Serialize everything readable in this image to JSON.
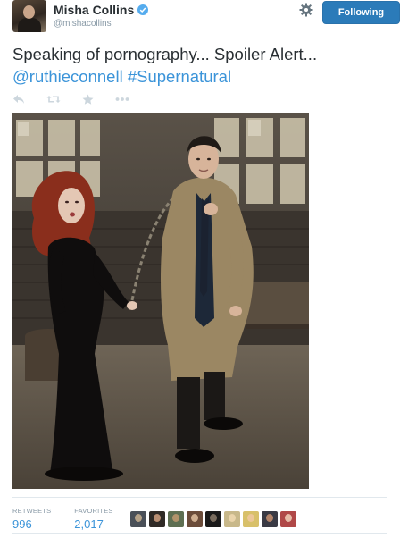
{
  "header": {
    "display_name": "Misha Collins",
    "handle": "@mishacollins",
    "verified_icon": "verified-badge-icon",
    "settings_icon": "gear-icon",
    "follow_label": "Following"
  },
  "tweet": {
    "text": "Speaking of pornography... Spoiler Alert...",
    "mention": "@ruthieconnell",
    "hashtag": "#Supernatural"
  },
  "actions": [
    "reply-icon",
    "retweet-icon",
    "favorite-icon",
    "more-icon"
  ],
  "stats": {
    "retweets_label": "RETWEETS",
    "retweets_value": "996",
    "favorites_label": "FAVORITES",
    "favorites_value": "2,017"
  },
  "favoriters": [
    {
      "bg": "#4a5058",
      "face": "#c8b090"
    },
    {
      "bg": "#2f2a26",
      "face": "#d0a080"
    },
    {
      "bg": "#5e6f52",
      "face": "#c09a70"
    },
    {
      "bg": "#6b4c3a",
      "face": "#e0c0a0"
    },
    {
      "bg": "#1a1a1a",
      "face": "#8a7a6a"
    },
    {
      "bg": "#c8b88a",
      "face": "#f0d8b0"
    },
    {
      "bg": "#d8c06a",
      "face": "#f0c8a0"
    },
    {
      "bg": "#3a3a44",
      "face": "#c89070"
    },
    {
      "bg": "#b04848",
      "face": "#f0d0b8"
    }
  ],
  "colors": {
    "link": "#3b94d9",
    "follow_bg": "#2b7bb9",
    "text": "#292f33",
    "muted": "#8899a6"
  }
}
